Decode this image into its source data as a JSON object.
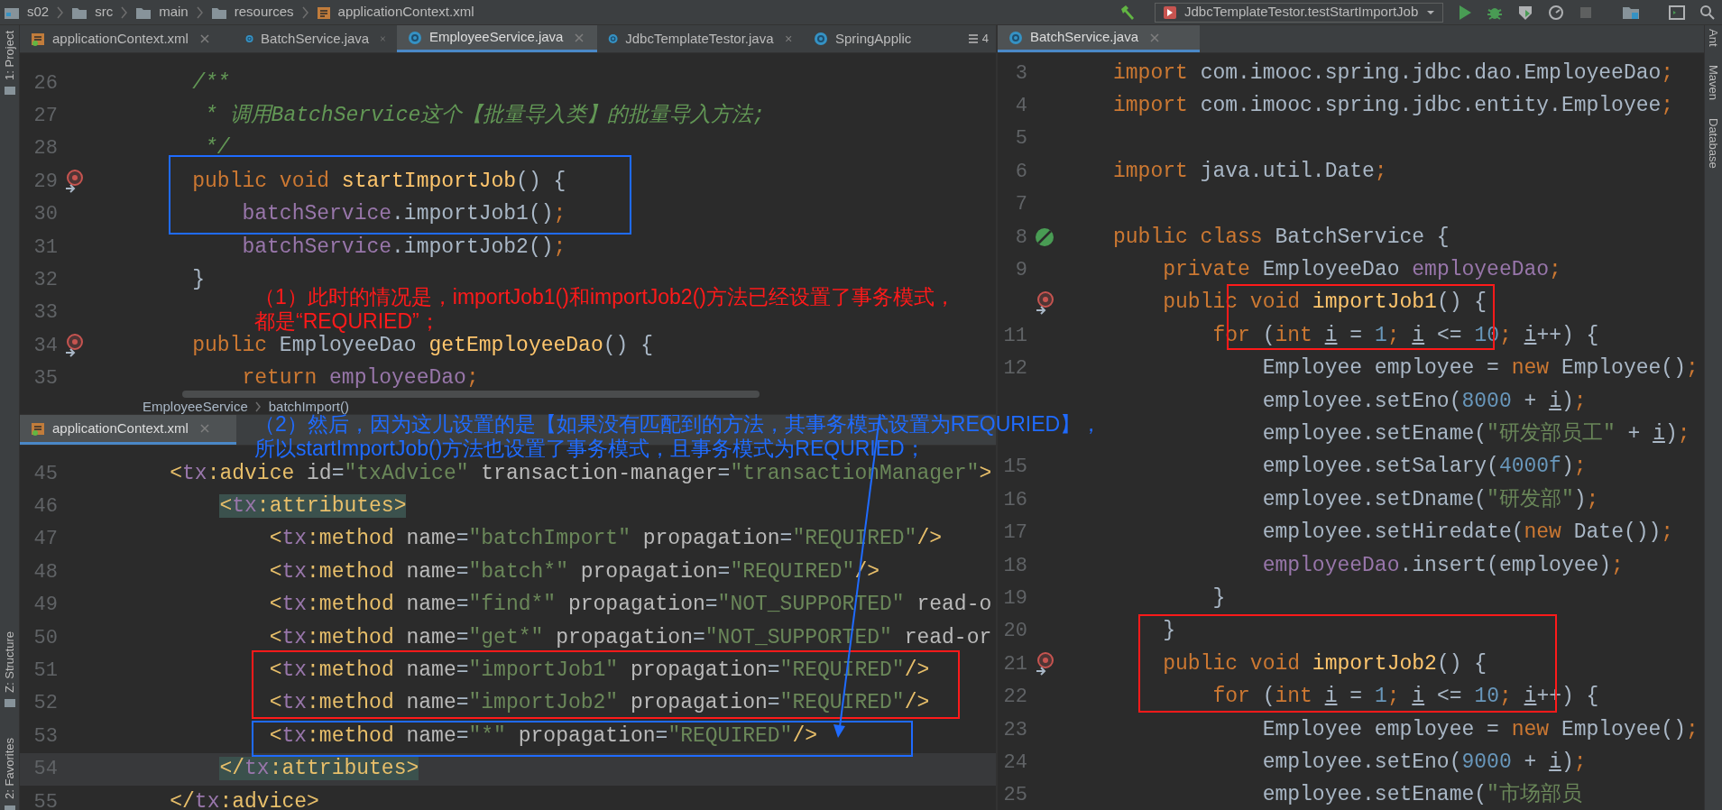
{
  "breadcrumbs": [
    "s02",
    "src",
    "main",
    "resources",
    "applicationContext.xml"
  ],
  "run_config": "JdbcTemplateTestor.testStartImportJob",
  "left_tool_strip": [
    "1: Project",
    "Z: Structure",
    "2: Favorites"
  ],
  "right_tool_strip": [
    "Ant",
    "Maven",
    "Database"
  ],
  "tabs": [
    {
      "label": "applicationContext.xml",
      "kind": "xml",
      "selected": false
    },
    {
      "label": "BatchService.java",
      "kind": "java",
      "selected": false
    },
    {
      "label": "EmployeeService.java",
      "kind": "java",
      "selected": true
    },
    {
      "label": "JdbcTemplateTestor.java",
      "kind": "java",
      "selected": false
    },
    {
      "label": "SpringApplic",
      "kind": "java",
      "selected": false
    }
  ],
  "tab_overflow_count": "4",
  "top_editor": {
    "lines": [
      {
        "number": "26",
        "tokens": [
          {
            "kind": "comment",
            "text": "    /**"
          }
        ]
      },
      {
        "number": "27",
        "tokens": [
          {
            "kind": "comment",
            "text": "     * 调用BatchService这个【批量导入类】的批量导入方法;"
          }
        ]
      },
      {
        "number": "28",
        "tokens": [
          {
            "kind": "comment",
            "text": "     */"
          }
        ]
      },
      {
        "number": "29",
        "kind": "override",
        "tokens": [
          {
            "kind": "kw",
            "text": "    public void "
          },
          {
            "kind": "fn",
            "text": "startImportJob"
          },
          {
            "kind": "plain",
            "text": "() {"
          }
        ]
      },
      {
        "number": "30",
        "tokens": [
          {
            "kind": "field",
            "text": "        batchService"
          },
          {
            "kind": "plain",
            "text": ".importJob1()"
          },
          {
            "kind": "kw",
            "text": ";"
          }
        ]
      },
      {
        "number": "31",
        "tokens": [
          {
            "kind": "field",
            "text": "        batchService"
          },
          {
            "kind": "plain",
            "text": ".importJob2()"
          },
          {
            "kind": "kw",
            "text": ";"
          }
        ]
      },
      {
        "number": "32",
        "tokens": [
          {
            "kind": "plain",
            "text": "    }"
          }
        ]
      },
      {
        "number": "33"
      },
      {
        "number": "34",
        "kind": "override",
        "tokens": [
          {
            "kind": "kw",
            "text": "    public "
          },
          {
            "kind": "plain",
            "text": "EmployeeDao "
          },
          {
            "kind": "fn",
            "text": "getEmployeeDao"
          },
          {
            "kind": "plain",
            "text": "() {"
          }
        ]
      },
      {
        "number": "35",
        "tokens": [
          {
            "kind": "kw",
            "text": "        return "
          },
          {
            "kind": "field",
            "text": "employeeDao"
          },
          {
            "kind": "kw",
            "text": ";"
          }
        ]
      }
    ]
  },
  "breadcrumb_bar": [
    "EmployeeService",
    "batchImport()"
  ],
  "bottom_editor": {
    "tab": {
      "label": "applicationContext.xml",
      "kind": "xml",
      "selected": true
    },
    "lines": [
      {
        "number": "45",
        "current": false,
        "tokens": [
          {
            "kind": "tag",
            "text": "    <"
          },
          {
            "kind": "ns",
            "text": "tx"
          },
          {
            "kind": "tag",
            "text": ":advice "
          },
          {
            "kind": "attr",
            "text": "id"
          },
          {
            "kind": "plain",
            "text": "="
          },
          {
            "kind": "str",
            "text": "\"txAdvice\" "
          },
          {
            "kind": "attr",
            "text": "transaction-manager"
          },
          {
            "kind": "plain",
            "text": "="
          },
          {
            "kind": "str",
            "text": "\"transactionManager\""
          },
          {
            "kind": "tag",
            "text": ">"
          }
        ]
      },
      {
        "number": "46",
        "current": false,
        "tokens": [
          {
            "kind": "match_tag",
            "text": "        <"
          },
          {
            "kind": "match_ns",
            "text": "tx"
          },
          {
            "kind": "match_tag",
            "text": ":attributes>"
          }
        ]
      },
      {
        "number": "47",
        "current": false,
        "tokens": [
          {
            "kind": "tag",
            "text": "            <"
          },
          {
            "kind": "ns",
            "text": "tx"
          },
          {
            "kind": "tag",
            "text": ":method "
          },
          {
            "kind": "attr",
            "text": "name"
          },
          {
            "kind": "plain",
            "text": "="
          },
          {
            "kind": "str",
            "text": "\"batchImport\" "
          },
          {
            "kind": "attr",
            "text": "propagation"
          },
          {
            "kind": "plain",
            "text": "="
          },
          {
            "kind": "str",
            "text": "\"REQUIRED\""
          },
          {
            "kind": "tag",
            "text": "/>"
          }
        ]
      },
      {
        "number": "48",
        "current": false,
        "tokens": [
          {
            "kind": "tag",
            "text": "            <"
          },
          {
            "kind": "ns",
            "text": "tx"
          },
          {
            "kind": "tag",
            "text": ":method "
          },
          {
            "kind": "attr",
            "text": "name"
          },
          {
            "kind": "plain",
            "text": "="
          },
          {
            "kind": "str",
            "text": "\"batch*\" "
          },
          {
            "kind": "attr",
            "text": "propagation"
          },
          {
            "kind": "plain",
            "text": "="
          },
          {
            "kind": "str",
            "text": "\"REQUIRED\""
          },
          {
            "kind": "tag",
            "text": "/>"
          }
        ]
      },
      {
        "number": "49",
        "current": false,
        "tokens": [
          {
            "kind": "tag",
            "text": "            <"
          },
          {
            "kind": "ns",
            "text": "tx"
          },
          {
            "kind": "tag",
            "text": ":method "
          },
          {
            "kind": "attr",
            "text": "name"
          },
          {
            "kind": "plain",
            "text": "="
          },
          {
            "kind": "str",
            "text": "\"find*\" "
          },
          {
            "kind": "attr",
            "text": "propagation"
          },
          {
            "kind": "plain",
            "text": "="
          },
          {
            "kind": "str",
            "text": "\"NOT_SUPPORTED\" "
          },
          {
            "kind": "attr",
            "text": "read-o"
          }
        ]
      },
      {
        "number": "50",
        "current": false,
        "tokens": [
          {
            "kind": "tag",
            "text": "            <"
          },
          {
            "kind": "ns",
            "text": "tx"
          },
          {
            "kind": "tag",
            "text": ":method "
          },
          {
            "kind": "attr",
            "text": "name"
          },
          {
            "kind": "plain",
            "text": "="
          },
          {
            "kind": "str",
            "text": "\"get*\" "
          },
          {
            "kind": "attr",
            "text": "propagation"
          },
          {
            "kind": "plain",
            "text": "="
          },
          {
            "kind": "str",
            "text": "\"NOT_SUPPORTED\" "
          },
          {
            "kind": "attr",
            "text": "read-or"
          }
        ]
      },
      {
        "number": "51",
        "current": false,
        "tokens": [
          {
            "kind": "tag",
            "text": "            <"
          },
          {
            "kind": "ns",
            "text": "tx"
          },
          {
            "kind": "tag",
            "text": ":method "
          },
          {
            "kind": "attr",
            "text": "name"
          },
          {
            "kind": "plain",
            "text": "="
          },
          {
            "kind": "str",
            "text": "\"importJob1\" "
          },
          {
            "kind": "attr",
            "text": "propagation"
          },
          {
            "kind": "plain",
            "text": "="
          },
          {
            "kind": "str",
            "text": "\"REQUIRED\""
          },
          {
            "kind": "tag",
            "text": "/>"
          }
        ]
      },
      {
        "number": "52",
        "current": false,
        "tokens": [
          {
            "kind": "tag",
            "text": "            <"
          },
          {
            "kind": "ns",
            "text": "tx"
          },
          {
            "kind": "tag",
            "text": ":method "
          },
          {
            "kind": "attr",
            "text": "name"
          },
          {
            "kind": "plain",
            "text": "="
          },
          {
            "kind": "str",
            "text": "\"importJob2\" "
          },
          {
            "kind": "attr",
            "text": "propagation"
          },
          {
            "kind": "plain",
            "text": "="
          },
          {
            "kind": "str",
            "text": "\"REQUIRED\""
          },
          {
            "kind": "tag",
            "text": "/>"
          }
        ]
      },
      {
        "number": "53",
        "current": false,
        "tokens": [
          {
            "kind": "tag",
            "text": "            <"
          },
          {
            "kind": "ns",
            "text": "tx"
          },
          {
            "kind": "tag",
            "text": ":method "
          },
          {
            "kind": "attr",
            "text": "name"
          },
          {
            "kind": "plain",
            "text": "="
          },
          {
            "kind": "str",
            "text": "\"*\" "
          },
          {
            "kind": "attr",
            "text": "propagation"
          },
          {
            "kind": "plain",
            "text": "="
          },
          {
            "kind": "str",
            "text": "\"REQUIRED\""
          },
          {
            "kind": "tag",
            "text": "/>"
          }
        ]
      },
      {
        "number": "54",
        "current": true,
        "tokens": [
          {
            "kind": "match_tag",
            "text": "        </"
          },
          {
            "kind": "match_ns",
            "text": "tx"
          },
          {
            "kind": "match_tag",
            "text": ":attributes>"
          }
        ]
      },
      {
        "number": "55",
        "current": false,
        "tokens": [
          {
            "kind": "tag",
            "text": "    </"
          },
          {
            "kind": "ns",
            "text": "tx"
          },
          {
            "kind": "tag",
            "text": ":advice>"
          }
        ]
      }
    ]
  },
  "right_editor": {
    "tab": {
      "label": "BatchService.java",
      "kind": "java",
      "selected": true
    },
    "lines": [
      {
        "number": "3",
        "tokens": [
          {
            "kind": "kw",
            "text": "import "
          },
          {
            "kind": "plain",
            "text": "com.imooc.spring.jdbc.dao.EmployeeDao"
          },
          {
            "kind": "kw",
            "text": ";"
          }
        ]
      },
      {
        "number": "4",
        "tokens": [
          {
            "kind": "kw",
            "text": "import "
          },
          {
            "kind": "plain",
            "text": "com.imooc.spring.jdbc.entity.Employee"
          },
          {
            "kind": "kw",
            "text": ";"
          }
        ]
      },
      {
        "number": "5"
      },
      {
        "number": "6",
        "tokens": [
          {
            "kind": "kw",
            "text": "import "
          },
          {
            "kind": "plain",
            "text": "java.util.Date"
          },
          {
            "kind": "kw",
            "text": ";"
          }
        ]
      },
      {
        "number": "7"
      },
      {
        "number": "8",
        "kind": "class",
        "tokens": [
          {
            "kind": "kw",
            "text": "public class "
          },
          {
            "kind": "plain",
            "text": "BatchService {"
          }
        ]
      },
      {
        "number": "9",
        "tokens": [
          {
            "kind": "kw",
            "text": "    private "
          },
          {
            "kind": "plain",
            "text": "EmployeeDao "
          },
          {
            "kind": "field",
            "text": "employeeDao"
          },
          {
            "kind": "kw",
            "text": ";"
          }
        ]
      },
      {
        "kind": "override",
        "tokens": [
          {
            "kind": "kw",
            "text": "    public void "
          },
          {
            "kind": "fn",
            "text": "importJob1"
          },
          {
            "kind": "plain",
            "text": "() {"
          }
        ]
      },
      {
        "number": "11",
        "tokens": [
          {
            "kind": "kw",
            "text": "        for "
          },
          {
            "kind": "plain",
            "text": "("
          },
          {
            "kind": "kw",
            "text": "int "
          },
          {
            "kind": "var",
            "text": "i"
          },
          {
            "kind": "plain",
            "text": " = "
          },
          {
            "kind": "num",
            "text": "1"
          },
          {
            "kind": "kw",
            "text": "; "
          },
          {
            "kind": "var",
            "text": "i"
          },
          {
            "kind": "plain",
            "text": " <= "
          },
          {
            "kind": "num",
            "text": "10"
          },
          {
            "kind": "kw",
            "text": "; "
          },
          {
            "kind": "var",
            "text": "i"
          },
          {
            "kind": "plain",
            "text": "++) {"
          }
        ]
      },
      {
        "number": "12",
        "tokens": [
          {
            "kind": "plain",
            "text": "            Employee employee = "
          },
          {
            "kind": "kw",
            "text": "new "
          },
          {
            "kind": "plain",
            "text": "Employee()"
          },
          {
            "kind": "kw",
            "text": ";"
          }
        ]
      },
      {
        "tokens": [
          {
            "kind": "plain",
            "text": "            employee.setEno("
          },
          {
            "kind": "num",
            "text": "8000"
          },
          {
            "kind": "plain",
            "text": " + "
          },
          {
            "kind": "var",
            "text": "i"
          },
          {
            "kind": "plain",
            "text": ")"
          },
          {
            "kind": "kw",
            "text": ";"
          }
        ]
      },
      {
        "tokens": [
          {
            "kind": "plain",
            "text": "            employee.setEname("
          },
          {
            "kind": "str",
            "text": "\"研发部员工\""
          },
          {
            "kind": "plain",
            "text": " + "
          },
          {
            "kind": "var",
            "text": "i"
          },
          {
            "kind": "plain",
            "text": ")"
          },
          {
            "kind": "kw",
            "text": ";"
          }
        ]
      },
      {
        "number": "15",
        "tokens": [
          {
            "kind": "plain",
            "text": "            employee.setSalary("
          },
          {
            "kind": "num",
            "text": "4000f"
          },
          {
            "kind": "plain",
            "text": ")"
          },
          {
            "kind": "kw",
            "text": ";"
          }
        ]
      },
      {
        "number": "16",
        "tokens": [
          {
            "kind": "plain",
            "text": "            employee.setDname("
          },
          {
            "kind": "str",
            "text": "\"研发部\""
          },
          {
            "kind": "plain",
            "text": ")"
          },
          {
            "kind": "kw",
            "text": ";"
          }
        ]
      },
      {
        "number": "17",
        "tokens": [
          {
            "kind": "plain",
            "text": "            employee.setHiredate("
          },
          {
            "kind": "kw",
            "text": "new "
          },
          {
            "kind": "plain",
            "text": "Date())"
          },
          {
            "kind": "kw",
            "text": ";"
          }
        ]
      },
      {
        "number": "18",
        "tokens": [
          {
            "kind": "field",
            "text": "            employeeDao"
          },
          {
            "kind": "plain",
            "text": ".insert(employee)"
          },
          {
            "kind": "kw",
            "text": ";"
          }
        ]
      },
      {
        "number": "19",
        "tokens": [
          {
            "kind": "plain",
            "text": "        }"
          }
        ]
      },
      {
        "number": "20",
        "tokens": [
          {
            "kind": "plain",
            "text": "    }"
          }
        ]
      },
      {
        "number": "21",
        "kind": "override",
        "tokens": [
          {
            "kind": "kw",
            "text": "    public void "
          },
          {
            "kind": "fn",
            "text": "importJob2"
          },
          {
            "kind": "plain",
            "text": "() {"
          }
        ]
      },
      {
        "number": "22",
        "tokens": [
          {
            "kind": "kw",
            "text": "        for "
          },
          {
            "kind": "plain",
            "text": "("
          },
          {
            "kind": "kw",
            "text": "int "
          },
          {
            "kind": "var",
            "text": "i"
          },
          {
            "kind": "plain",
            "text": " = "
          },
          {
            "kind": "num",
            "text": "1"
          },
          {
            "kind": "kw",
            "text": "; "
          },
          {
            "kind": "var",
            "text": "i"
          },
          {
            "kind": "plain",
            "text": " <= "
          },
          {
            "kind": "num",
            "text": "10"
          },
          {
            "kind": "kw",
            "text": "; "
          },
          {
            "kind": "var",
            "text": "i"
          },
          {
            "kind": "plain",
            "text": "++) {"
          }
        ]
      },
      {
        "number": "23",
        "tokens": [
          {
            "kind": "plain",
            "text": "            Employee employee = "
          },
          {
            "kind": "kw",
            "text": "new "
          },
          {
            "kind": "plain",
            "text": "Employee()"
          },
          {
            "kind": "kw",
            "text": ";"
          }
        ]
      },
      {
        "number": "24",
        "tokens": [
          {
            "kind": "plain",
            "text": "            employee.setEno("
          },
          {
            "kind": "num",
            "text": "9000"
          },
          {
            "kind": "plain",
            "text": " + "
          },
          {
            "kind": "var",
            "text": "i"
          },
          {
            "kind": "plain",
            "text": ")"
          },
          {
            "kind": "kw",
            "text": ";"
          }
        ]
      },
      {
        "number": "25",
        "tokens": [
          {
            "kind": "plain",
            "text": "            employee.setEname("
          },
          {
            "kind": "str",
            "text": "\"市场部员"
          }
        ]
      }
    ]
  },
  "annotations": [
    {
      "color": "#ff1a1a",
      "lines": [
        "（1）此时的情况是，importJob1()和importJob2()方法已经设置了事务模式，",
        "都是“REQURIED”；"
      ]
    },
    {
      "color": "#1f6bff",
      "lines": [
        "（2）然后，因为这儿设置的是【如果没有匹配到的方法，其事务模式设置为REQURIED】，",
        "所以startImportJob()方法也设置了事务模式，且事务模式为REQURIED；"
      ]
    }
  ]
}
